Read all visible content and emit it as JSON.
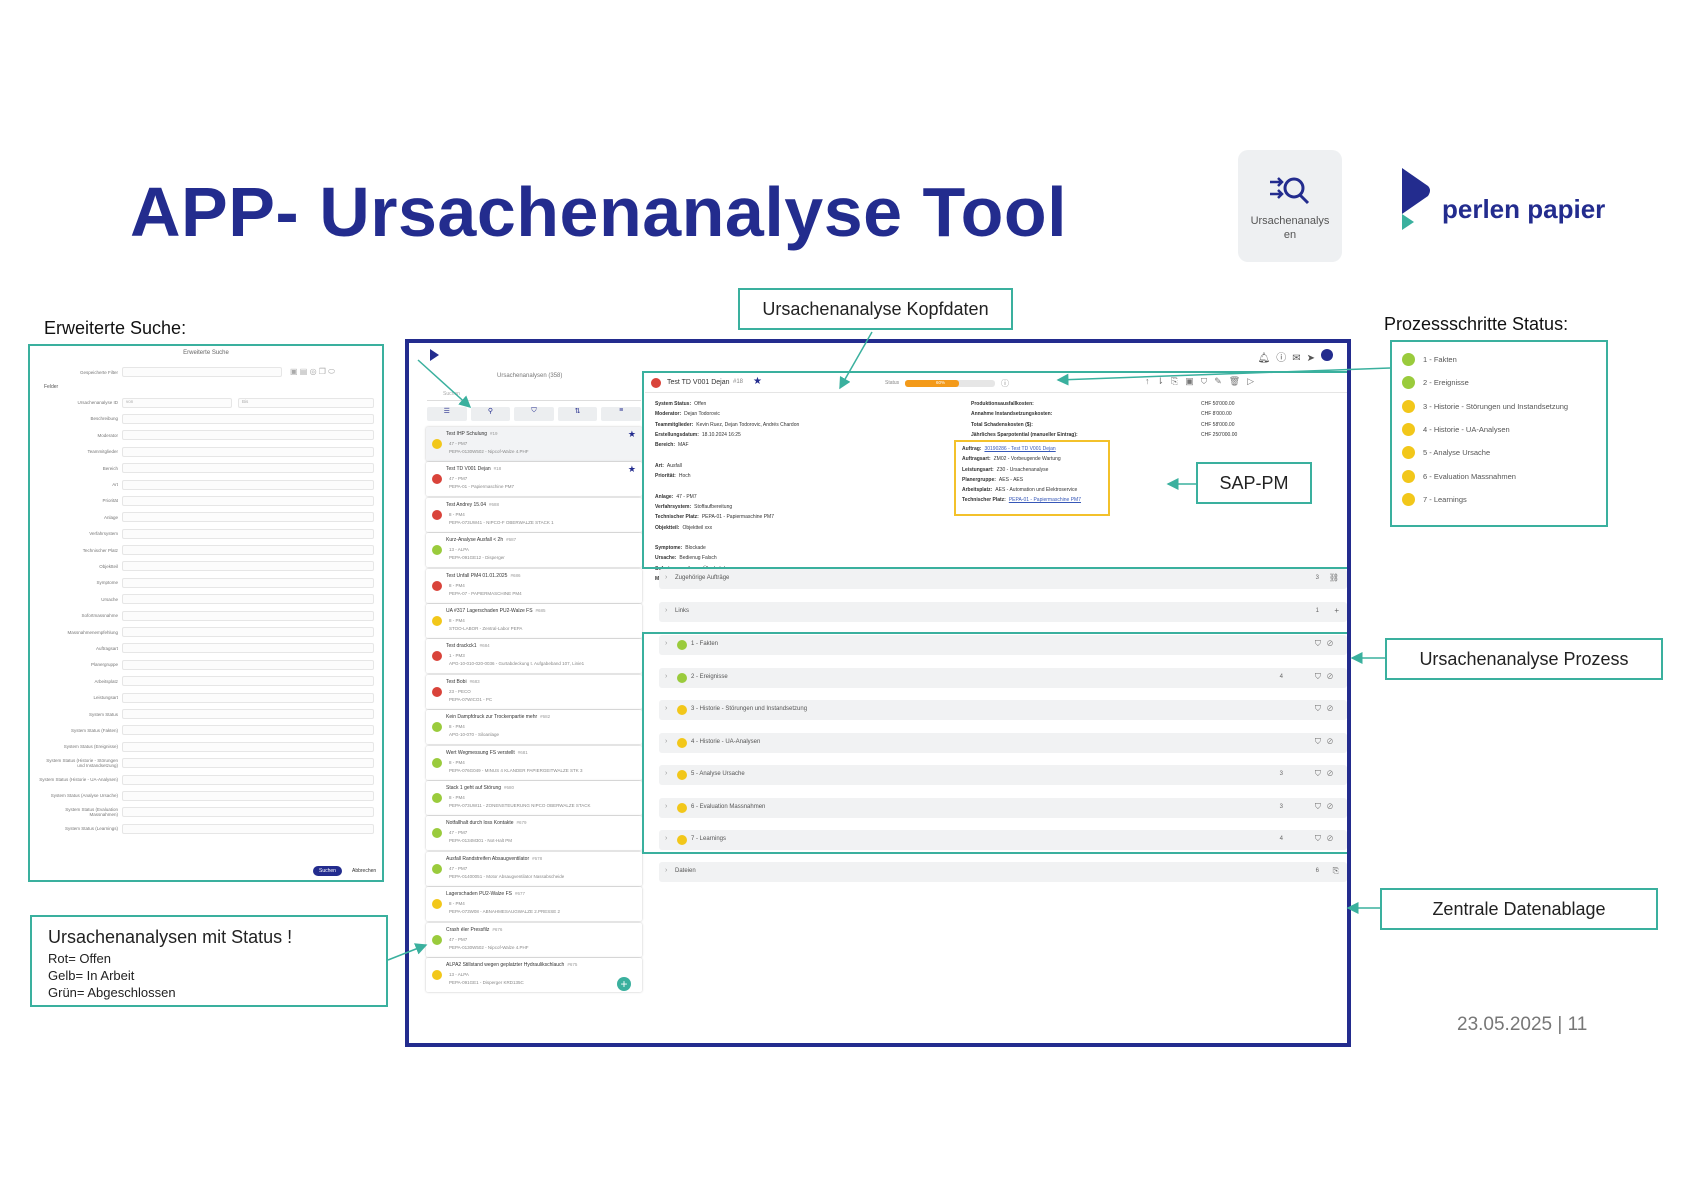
{
  "slide": {
    "title": "APP- Ursachenanalyse Tool",
    "date_page": "23.05.2025 | 11",
    "app_tile_label": "Ursachenanalysen",
    "logo_text": "perlen papier",
    "colors": {
      "navy": "#232c8e",
      "teal": "#3ab09e",
      "red": "#d9433a",
      "yellow": "#f2c71a",
      "green": "#9acb3c",
      "orange": "#f39a1a",
      "highlight": "#f3c12b"
    }
  },
  "annotations": {
    "erweiterte_suche": "Erweiterte Suche:",
    "kopfdaten": "Ursachenanalyse Kopfdaten",
    "prozessschritte": "Prozessschritte Status:",
    "sap_pm": "SAP-PM",
    "prozess": "Ursachenanalyse Prozess",
    "datenablage": "Zentrale Datenablage",
    "status_title": "Ursachenanalysen mit Status !",
    "status_lines": [
      "Rot= Offen",
      "Gelb= In Arbeit",
      "Grün= Abgeschlossen"
    ]
  },
  "search_panel": {
    "title": "Erweiterte Suche",
    "filter_label": "Gespeicherte Filter",
    "section": "Felder",
    "fields": [
      "Ursachenanalyse ID",
      "Beschreibung",
      "Moderator",
      "Teammitglieder",
      "Bereich",
      "Art",
      "Priorität",
      "Anlage",
      "Verfahrsystem",
      "Technischer Platz",
      "Objektteil",
      "Symptome",
      "Ursache",
      "Sofortmassnahme",
      "Massnahmenempfehlung",
      "Auftragsart",
      "Planergruppe",
      "Arbeitsplatz",
      "Leistungsart",
      "System Status",
      "System Status (Fakten)",
      "System Status (Ereignisse)",
      "System Status (Historie - Störungen und Instandsetzung)",
      "System Status (Historie - UA-Analysen)",
      "System Status (Analyse Ursache)",
      "System Status (Evaluation Massnahmen)",
      "System Status (Learnings)"
    ],
    "id_from": "von",
    "id_to": "Bis",
    "search_button": "Suchen",
    "cancel_button": "Abbrechen"
  },
  "list": {
    "header": "Ursachenanalysen (358)",
    "search_placeholder": "Suchen",
    "items": [
      {
        "title": "Test IHP Schulung",
        "num": "#19",
        "line1": "47 - PM7",
        "line2": "PEPA-0130W502 - Nipcof-Walze 4.PHF",
        "status": "yellow",
        "starred": true
      },
      {
        "title": "Test TD V001 Dejan",
        "num": "#18",
        "line1": "47 - PM7",
        "line2": "PEPA-01 - Papiermaschine PM7",
        "status": "red",
        "starred": true
      },
      {
        "title": "Test Andrey 15.04",
        "num": "#688",
        "line1": "8 - PM4",
        "line2": "PEPA-073UW41 - NIPCO-F OBERWALZE STACK 1",
        "status": "red",
        "starred": false
      },
      {
        "title": "Kurz-Analyse Ausfall < 2h",
        "num": "#687",
        "line1": "13 - ALPA",
        "line2": "PEPA-091GE12 - Disperger",
        "status": "green",
        "starred": false
      },
      {
        "title": "Test Unfall PM4 01.01.2025",
        "num": "#686",
        "line1": "8 - PM4",
        "line2": "PEPA-07 - PAPIERMASCHINE PM4",
        "status": "red",
        "starred": false
      },
      {
        "title": "UA #317 Lagerschaden PU2-Walze FS",
        "num": "#685",
        "line1": "8 - PM4",
        "line2": "STOO-LABOR - Zentral-Labor PEPA",
        "status": "yellow",
        "starred": false
      },
      {
        "title": "Test drackck1",
        "num": "#684",
        "line1": "1 - PM3",
        "line2": "APG-10-010-020-0036 - Gurtabdeckung t. Aufgabeband 107, Linie1",
        "status": "red",
        "starred": false
      },
      {
        "title": "Test Bobi",
        "num": "#683",
        "line1": "23 - PECO",
        "line2": "PEPA-07WICO1 - PC",
        "status": "red",
        "starred": false
      },
      {
        "title": "Kein Dampfdruck zur Trockenpartie mehr",
        "num": "#682",
        "line1": "8 - PM4",
        "line2": "APG-10-070 - Siloanlage",
        "status": "green",
        "starred": false
      },
      {
        "title": "Wert Wegmessung FS verstellt",
        "num": "#681",
        "line1": "8 - PM4",
        "line2": "PEPA-076G049 - MINUS 4 KLANDER PAPIERGEITWALZE STK 3",
        "status": "green",
        "starred": false
      },
      {
        "title": "Stack 1 geht auf Störung",
        "num": "#680",
        "line1": "8 - PM4",
        "line2": "PEPA-073UW11 - ZONENSTEUERUNG NIPCO OBERWALZE STACK",
        "status": "green",
        "starred": false
      },
      {
        "title": "Notfallhalt durch loss Kontakte",
        "num": "#679",
        "line1": "47 - PM7",
        "line2": "PEPA-0134M301 - Not-Halt PM",
        "status": "green",
        "starred": false
      },
      {
        "title": "Ausfall Randstreifen Absaugventilator",
        "num": "#678",
        "line1": "47 - PM7",
        "line2": "PEPA-01400051 - Motor Absaugventilator Nassabscheide",
        "status": "green",
        "starred": false
      },
      {
        "title": "Lagerschaden PU2-Walze FS",
        "num": "#677",
        "line1": "8 - PM4",
        "line2": "PEPA-073W08 - ABNAHMESAUGWALZE 2.PRESSE 2",
        "status": "yellow",
        "starred": false
      },
      {
        "title": "Crash éler Pressfilz",
        "num": "#676",
        "line1": "47 - PM7",
        "line2": "PEPA-0130W502 - Nipcof-Walze 4.PHF",
        "status": "green",
        "starred": false
      },
      {
        "title": "ALPA2 Stillstand wegen geplatzter Hydraulikschlauch",
        "num": "#675",
        "line1": "13 - ALPA",
        "line2": "PEPA-091GE1 - Disperger KRD135C",
        "status": "yellow",
        "starred": false
      }
    ]
  },
  "detail": {
    "title": "Test TD V001 Dejan",
    "num": "#18",
    "status_label": "Status",
    "status_progress_text": "60%",
    "progress": 0.6,
    "left_fields": [
      [
        "System Status:",
        "Offen"
      ],
      [
        "Moderator:",
        "Dejan Todorovic"
      ],
      [
        "Teammitglieder:",
        "Kevin Ruez, Dejan Todorovic, Andrés Chardon"
      ],
      [
        "Erstellungsdatum:",
        "18.10.2024 16:25"
      ],
      [
        "Bereich:",
        "MAF"
      ],
      [
        "",
        ""
      ],
      [
        "Art:",
        "Ausfall"
      ],
      [
        "Priorität:",
        "Hoch"
      ],
      [
        "",
        ""
      ],
      [
        "Anlage:",
        "47 - PM7"
      ],
      [
        "Verfahrsystem:",
        "Stoffaufbereitung"
      ],
      [
        "Technischer Platz:",
        "PEPA-01 - Papiermaschine PM7"
      ],
      [
        "Objektteil:",
        "Objektteil xxx"
      ],
      [
        "",
        ""
      ],
      [
        "Symptome:",
        "Blockade"
      ],
      [
        "Ursache:",
        "Bedienug Falsch"
      ],
      [
        "Sofortmassnahme:",
        "Überbrückung"
      ],
      [
        "Massnahmenempfehlung:",
        "Schulung"
      ]
    ],
    "cost_fields": [
      [
        "Produktionsausfallkosten:",
        "CHF 50'000.00"
      ],
      [
        "Annahme Instandsetzungskosten:",
        "CHF 8'000.00"
      ],
      [
        "Total Schadenskosten ($):",
        "CHF 58'000.00"
      ],
      [
        "Jährliches Sparpotential (manueller Eintrag):",
        "CHF 250'000.00"
      ]
    ],
    "sap_fields": [
      [
        "Auftrag:",
        "30190286 - Test TD V001 Dejan"
      ],
      [
        "Auftragsart:",
        "ZM02 - Vorbeugende Wartung"
      ],
      [
        "Leistungsart:",
        "Z30 - Ursachenanalyse"
      ],
      [
        "Planergruppe:",
        "AES - AES"
      ],
      [
        "Arbeitsplatz:",
        "AES - Automation und Elektroservice"
      ],
      [
        "Technischer Platz:",
        "PEPA-01 - Papiermaschine PM7"
      ]
    ],
    "orders_row": {
      "label": "Zugehörige Aufträge",
      "count": "3"
    },
    "links_row": {
      "label": "Links",
      "count": "1"
    },
    "files_row": {
      "label": "Dateien",
      "count": "6"
    },
    "steps": [
      {
        "label": "1 - Fakten",
        "count": "",
        "status": "green"
      },
      {
        "label": "2 - Ereignisse",
        "count": "4",
        "status": "green"
      },
      {
        "label": "3 - Historie - Störungen und Instandsetzung",
        "count": "",
        "status": "yellow"
      },
      {
        "label": "4 - Historie - UA-Analysen",
        "count": "",
        "status": "yellow"
      },
      {
        "label": "5 - Analyse Ursache",
        "count": "3",
        "status": "yellow"
      },
      {
        "label": "6 - Evaluation Massnahmen",
        "count": "3",
        "status": "yellow"
      },
      {
        "label": "7 - Learnings",
        "count": "4",
        "status": "yellow"
      }
    ]
  },
  "status_list": {
    "items": [
      "1 - Fakten",
      "2 - Ereignisse",
      "3 - Historie - Störungen und Instandsetzung",
      "4 - Historie - UA-Analysen",
      "5 - Analyse Ursache",
      "6 - Evaluation Massnahmen",
      "7 - Learnings"
    ],
    "colors": [
      "#9acb3c",
      "#9acb3c",
      "#f2c71a",
      "#f2c71a",
      "#f2c71a",
      "#f2c71a",
      "#f2c71a"
    ]
  }
}
